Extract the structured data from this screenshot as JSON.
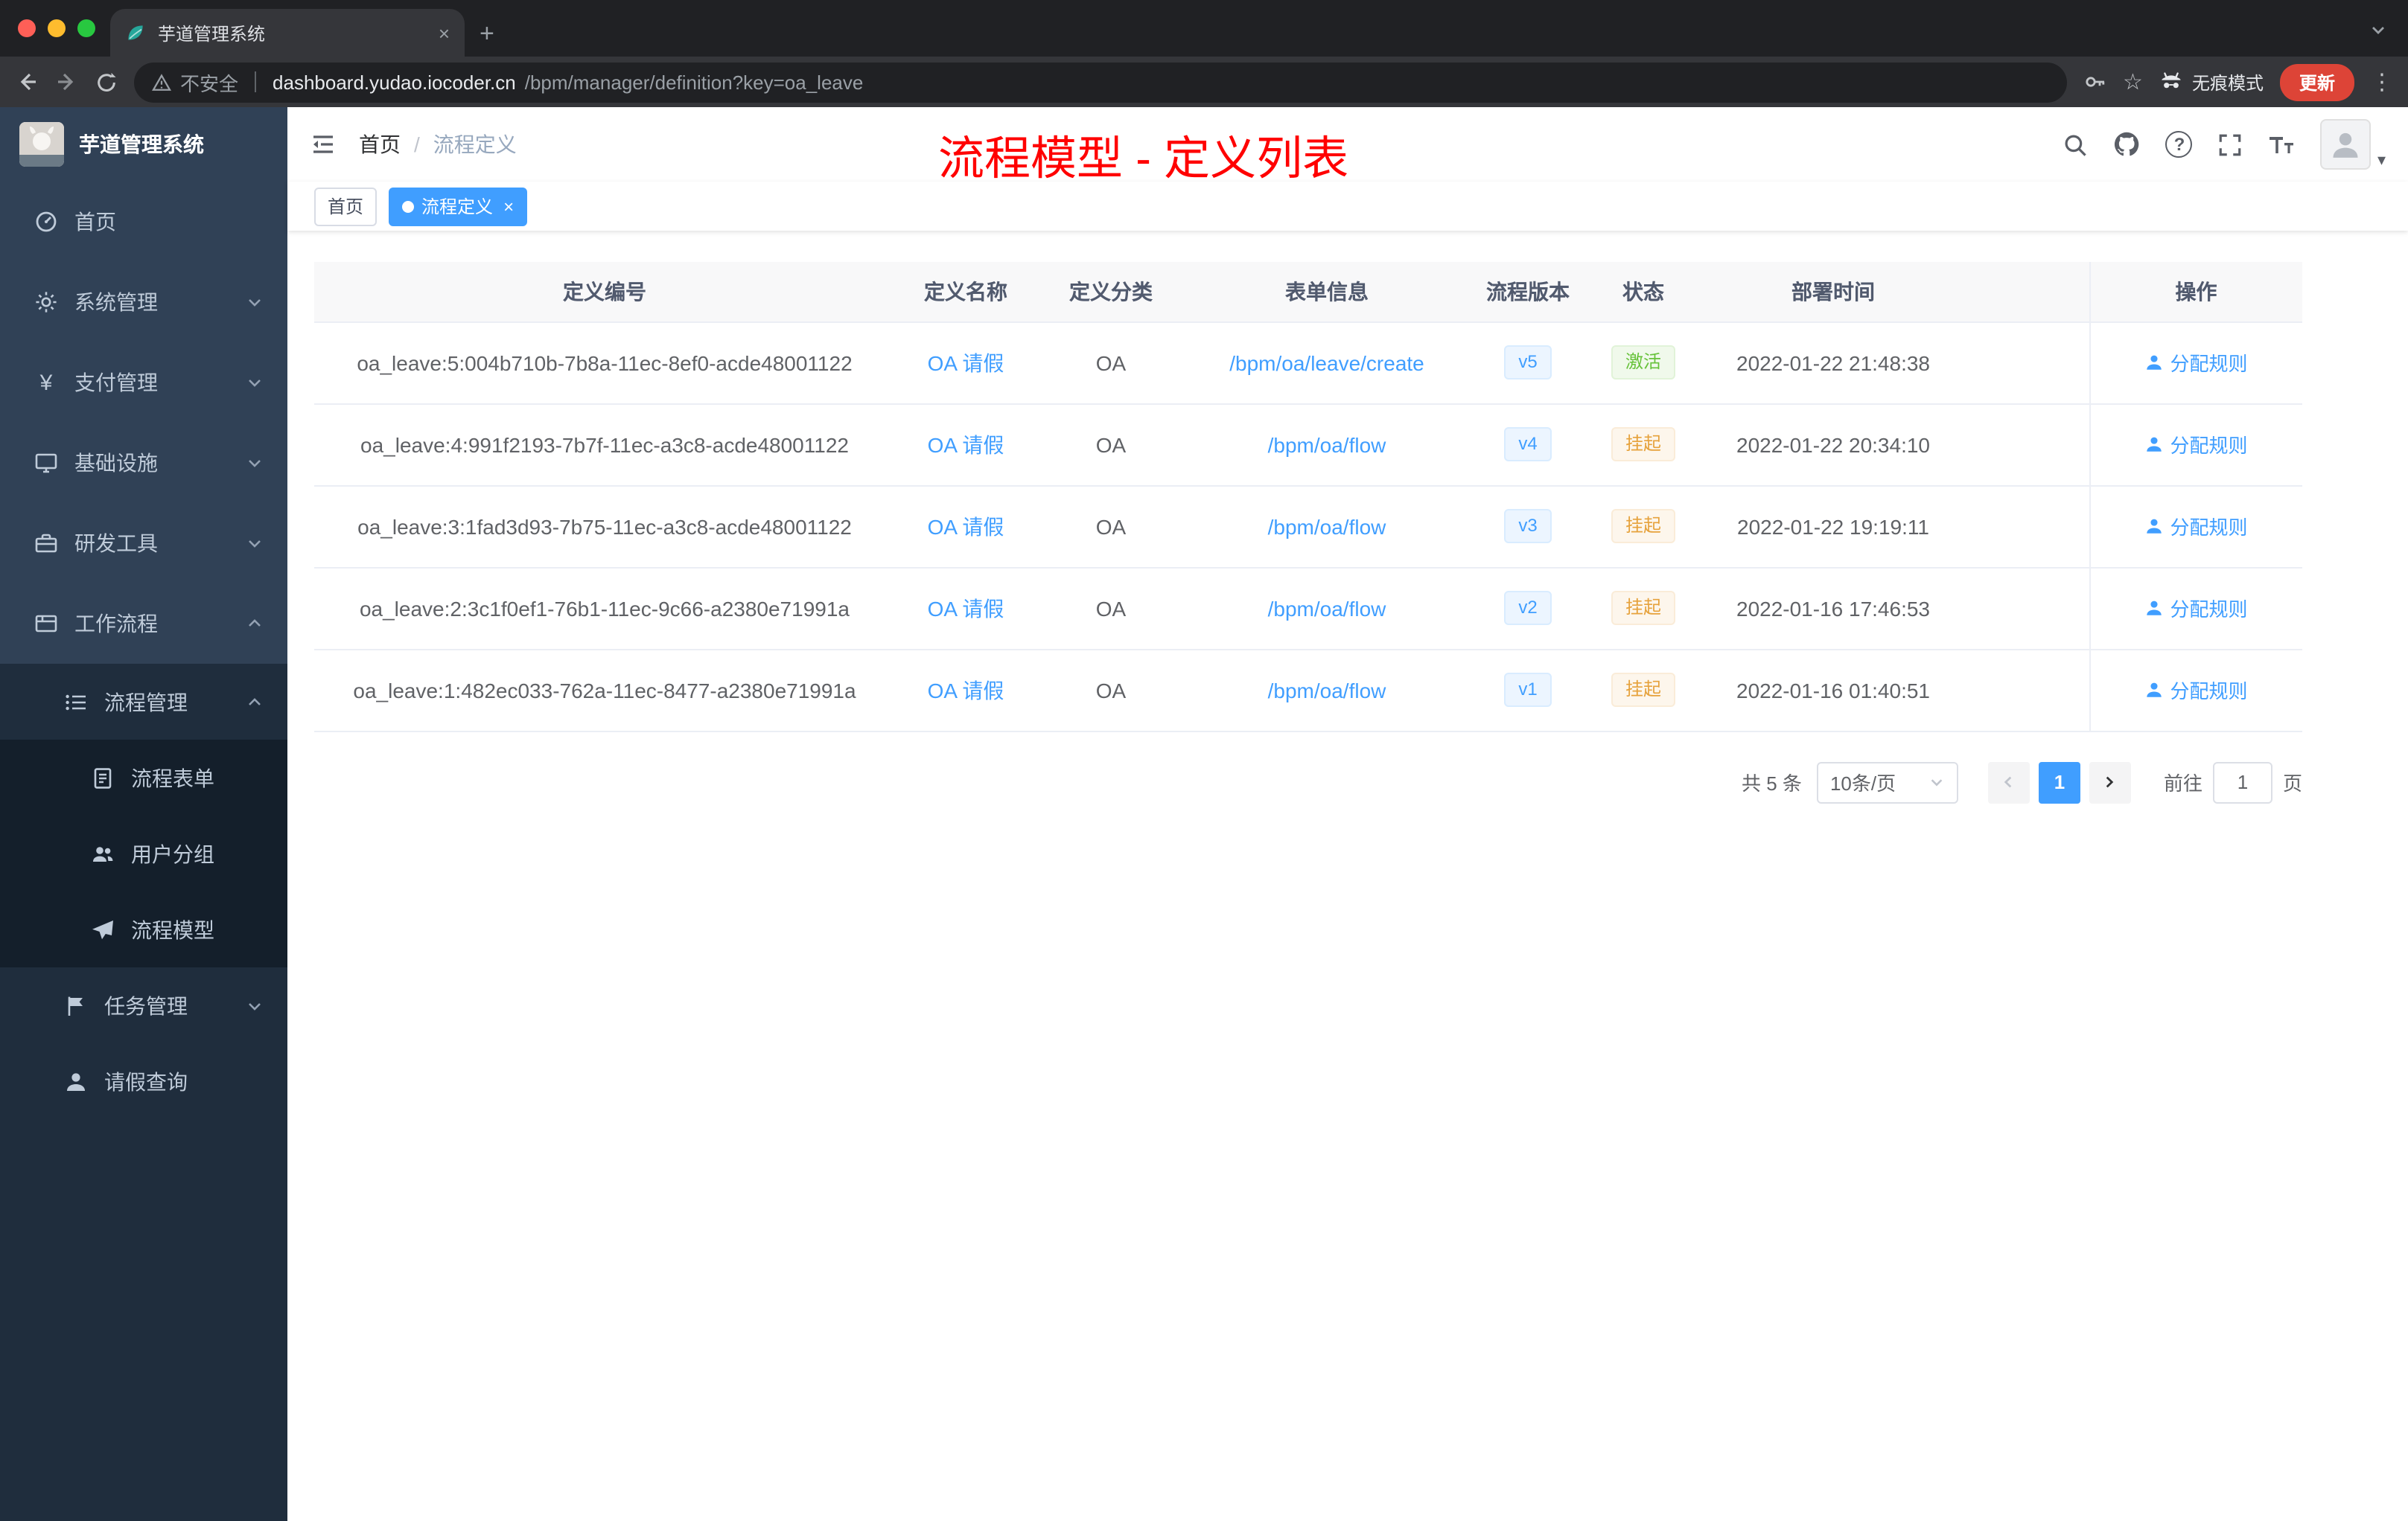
{
  "browser": {
    "tab_title": "芋道管理系统",
    "url_security": "不安全",
    "url_domain": "dashboard.yudao.iocoder.cn",
    "url_path": "/bpm/manager/definition?key=oa_leave",
    "incognito_label": "无痕模式",
    "update_label": "更新"
  },
  "icons": {
    "close": "×",
    "plus": "+",
    "kebab": "⋮",
    "star": "☆",
    "help": "?",
    "yen": "¥",
    "caret_down": "▾"
  },
  "sidebar": {
    "logo_title": "芋道管理系统",
    "items": [
      {
        "label": "首页"
      },
      {
        "label": "系统管理"
      },
      {
        "label": "支付管理"
      },
      {
        "label": "基础设施"
      },
      {
        "label": "研发工具"
      },
      {
        "label": "工作流程"
      },
      {
        "label": "流程管理"
      },
      {
        "label": "流程表单"
      },
      {
        "label": "用户分组"
      },
      {
        "label": "流程模型"
      },
      {
        "label": "任务管理"
      },
      {
        "label": "请假查询"
      }
    ]
  },
  "header": {
    "breadcrumb_home": "首页",
    "breadcrumb_separator": "/",
    "breadcrumb_current": "流程定义",
    "annotation": "流程模型 - 定义列表"
  },
  "tags": [
    {
      "label": "首页",
      "active": false
    },
    {
      "label": "流程定义",
      "active": true
    }
  ],
  "table": {
    "columns": [
      "定义编号",
      "定义名称",
      "定义分类",
      "表单信息",
      "流程版本",
      "状态",
      "部署时间",
      "操作"
    ],
    "rows": [
      {
        "id": "oa_leave:5:004b710b-7b8a-11ec-8ef0-acde48001122",
        "name": "OA 请假",
        "category": "OA",
        "form": "/bpm/oa/leave/create",
        "version": "v5",
        "status": "激活",
        "time": "2022-01-22 21:48:38",
        "action": "分配规则"
      },
      {
        "id": "oa_leave:4:991f2193-7b7f-11ec-a3c8-acde48001122",
        "name": "OA 请假",
        "category": "OA",
        "form": "/bpm/oa/flow",
        "version": "v4",
        "status": "挂起",
        "time": "2022-01-22 20:34:10",
        "action": "分配规则"
      },
      {
        "id": "oa_leave:3:1fad3d93-7b75-11ec-a3c8-acde48001122",
        "name": "OA 请假",
        "category": "OA",
        "form": "/bpm/oa/flow",
        "version": "v3",
        "status": "挂起",
        "time": "2022-01-22 19:19:11",
        "action": "分配规则"
      },
      {
        "id": "oa_leave:2:3c1f0ef1-76b1-11ec-9c66-a2380e71991a",
        "name": "OA 请假",
        "category": "OA",
        "form": "/bpm/oa/flow",
        "version": "v2",
        "status": "挂起",
        "time": "2022-01-16 17:46:53",
        "action": "分配规则"
      },
      {
        "id": "oa_leave:1:482ec033-762a-11ec-8477-a2380e71991a",
        "name": "OA 请假",
        "category": "OA",
        "form": "/bpm/oa/flow",
        "version": "v1",
        "status": "挂起",
        "time": "2022-01-16 01:40:51",
        "action": "分配规则"
      }
    ]
  },
  "pagination": {
    "total": "共 5 条",
    "page_size": "10条/页",
    "current_page": "1",
    "goto_label": "前往",
    "goto_value": "1",
    "page_label": "页"
  },
  "colors": {
    "accent_blue": "#409eff",
    "success_green": "#67c23a",
    "warning_orange": "#e6a23c",
    "sidebar_bg": "#304156",
    "sidebar_sub_bg": "#1f2d3d",
    "annotation_red": "#ff0000",
    "update_badge_red": "#dd4437",
    "tag_version_bg": "#ecf5ff",
    "status_active_bg": "#f0f9eb",
    "status_suspend_bg": "#fdf6ec"
  }
}
